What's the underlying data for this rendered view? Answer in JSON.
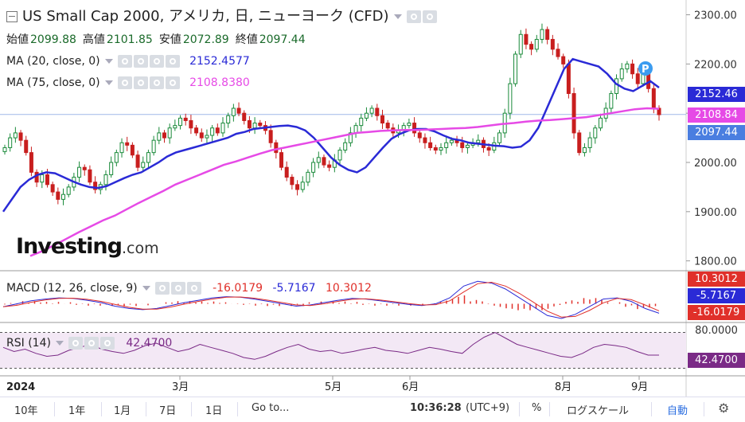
{
  "header": {
    "title": "US Small Cap 2000, アメリカ, 日, ニューヨーク (CFD)",
    "ohlc": [
      {
        "label": "始値",
        "value": "2099.88"
      },
      {
        "label": "高値",
        "value": "2101.85"
      },
      {
        "label": "安値",
        "value": "2072.89"
      },
      {
        "label": "終値",
        "value": "2097.44"
      }
    ]
  },
  "indicators": {
    "ma20": {
      "label": "MA (20, close, 0)",
      "value": "2152.4577",
      "color": "#2a2ad6"
    },
    "ma75": {
      "label": "MA (75, close, 0)",
      "value": "2108.8380",
      "color": "#e64ae6"
    },
    "macd": {
      "label": "MACD (12, 26, close, 9)",
      "macd": "-16.0179",
      "signal": "-5.7167",
      "hist": "10.3012"
    },
    "rsi": {
      "label": "RSI (14)",
      "value": "42.4700"
    }
  },
  "logo": {
    "main": "Investing",
    "suffix": ".com"
  },
  "price_tags": {
    "ma20": "2152.46",
    "ma75": "2108.84",
    "last": "2097.44",
    "macd_hist": "10.3012",
    "macd_signal": "-5.7167",
    "macd_line": "-16.0179",
    "rsi_top": "80.0000",
    "rsi_value": "42.4700"
  },
  "marker": "P",
  "xaxis": {
    "year": "2024",
    "months": [
      "3月",
      "5月",
      "6月",
      "8月",
      "9月"
    ]
  },
  "toolbar": {
    "ranges": [
      "10年",
      "1年",
      "1月",
      "7日",
      "1日"
    ],
    "goto": "Go to...",
    "time": "10:36:28",
    "tz": "(UTC+9)",
    "percent": "%",
    "log": "ログスケール",
    "auto": "自動"
  },
  "colors": {
    "up": "#1a8a3a",
    "down": "#c81e1e",
    "ma20": "#2a2ad6",
    "ma75": "#e64ae6",
    "macd": "#2a2ad6",
    "signal": "#e0302a",
    "rsi": "#7a2a86",
    "rsi_band": "#f3e8f5",
    "last_tag": "#4a7ee0"
  },
  "chart_data": {
    "type": "candlestick",
    "title": "US Small Cap 2000, アメリカ, 日, ニューヨーク (CFD)",
    "y_ticks": [
      1800,
      1900,
      2000,
      2100,
      2200,
      2300
    ],
    "ylim": [
      1780,
      2330
    ],
    "x_ticks": [
      "2024",
      "3月",
      "5月",
      "6月",
      "8月",
      "9月"
    ],
    "close_series": [
      2030,
      2050,
      2060,
      2045,
      2020,
      1980,
      1960,
      1975,
      1955,
      1940,
      1925,
      1935,
      1950,
      1970,
      1990,
      1985,
      1960,
      1945,
      1955,
      1975,
      2000,
      2020,
      2040,
      2035,
      2015,
      1990,
      2000,
      2020,
      2045,
      2060,
      2050,
      2070,
      2075,
      2090,
      2085,
      2070,
      2060,
      2050,
      2055,
      2070,
      2060,
      2080,
      2095,
      2110,
      2100,
      2085,
      2070,
      2080,
      2075,
      2065,
      2040,
      2020,
      1990,
      1970,
      1955,
      1945,
      1960,
      1980,
      2000,
      2010,
      1995,
      1990,
      2005,
      2025,
      2040,
      2060,
      2075,
      2090,
      2100,
      2110,
      2095,
      2080,
      2070,
      2060,
      2065,
      2075,
      2080,
      2060,
      2050,
      2040,
      2030,
      2025,
      2030,
      2040,
      2045,
      2040,
      2030,
      2035,
      2040,
      2045,
      2030,
      2025,
      2040,
      2060,
      2100,
      2160,
      2220,
      2260,
      2240,
      2230,
      2250,
      2270,
      2250,
      2230,
      2215,
      2200,
      2140,
      2060,
      2020,
      2030,
      2050,
      2070,
      2090,
      2110,
      2140,
      2170,
      2190,
      2200,
      2180,
      2160,
      2190,
      2150,
      2110,
      2097
    ],
    "ma20_series": [
      1900,
      1925,
      1950,
      1965,
      1975,
      1980,
      1978,
      1970,
      1962,
      1955,
      1950,
      1948,
      1952,
      1960,
      1968,
      1975,
      1980,
      1990,
      2000,
      2012,
      2020,
      2025,
      2030,
      2035,
      2040,
      2045,
      2050,
      2058,
      2062,
      2068,
      2070,
      2072,
      2074,
      2075,
      2072,
      2065,
      2050,
      2030,
      2010,
      1995,
      1985,
      1980,
      1990,
      2010,
      2030,
      2048,
      2058,
      2065,
      2068,
      2068,
      2063,
      2055,
      2048,
      2045,
      2040,
      2038,
      2036,
      2034,
      2033,
      2030,
      2032,
      2045,
      2070,
      2110,
      2150,
      2190,
      2210,
      2205,
      2200,
      2195,
      2180,
      2160,
      2150,
      2145,
      2155,
      2165,
      2152
    ],
    "ma75_series": [
      1810,
      1820,
      1832,
      1845,
      1858,
      1870,
      1882,
      1892,
      1905,
      1918,
      1930,
      1942,
      1955,
      1965,
      1975,
      1985,
      1995,
      2002,
      2010,
      2018,
      2025,
      2030,
      2035,
      2040,
      2045,
      2050,
      2055,
      2060,
      2062,
      2064,
      2065,
      2066,
      2066,
      2067,
      2068,
      2069,
      2070,
      2072,
      2075,
      2078,
      2080,
      2083,
      2085,
      2086,
      2088,
      2090,
      2092,
      2096,
      2100,
      2104,
      2108,
      2110,
      2109
    ],
    "macd_series": [
      -5,
      0,
      5,
      8,
      10,
      9,
      6,
      2,
      -4,
      -8,
      -10,
      -8,
      -3,
      2,
      6,
      10,
      12,
      11,
      8,
      4,
      0,
      -4,
      -2,
      2,
      6,
      9,
      8,
      5,
      2,
      -1,
      -3,
      0,
      10,
      30,
      38,
      35,
      25,
      10,
      -5,
      -20,
      -25,
      -18,
      -5,
      8,
      10,
      4,
      -8,
      -16
    ],
    "macd_hist_values": [
      10.3012
    ],
    "rsi_series": [
      55,
      48,
      52,
      45,
      40,
      42,
      50,
      55,
      60,
      52,
      48,
      45,
      50,
      58,
      62,
      55,
      48,
      52,
      60,
      55,
      50,
      45,
      38,
      35,
      40,
      48,
      55,
      60,
      52,
      48,
      50,
      45,
      48,
      52,
      55,
      50,
      48,
      45,
      50,
      55,
      52,
      48,
      45,
      60,
      72,
      80,
      70,
      60,
      55,
      50,
      45,
      40,
      38,
      45,
      55,
      60,
      58,
      55,
      48,
      42,
      42
    ],
    "rsi_range": [
      20,
      80
    ],
    "macd_range": [
      -50,
      50
    ]
  }
}
